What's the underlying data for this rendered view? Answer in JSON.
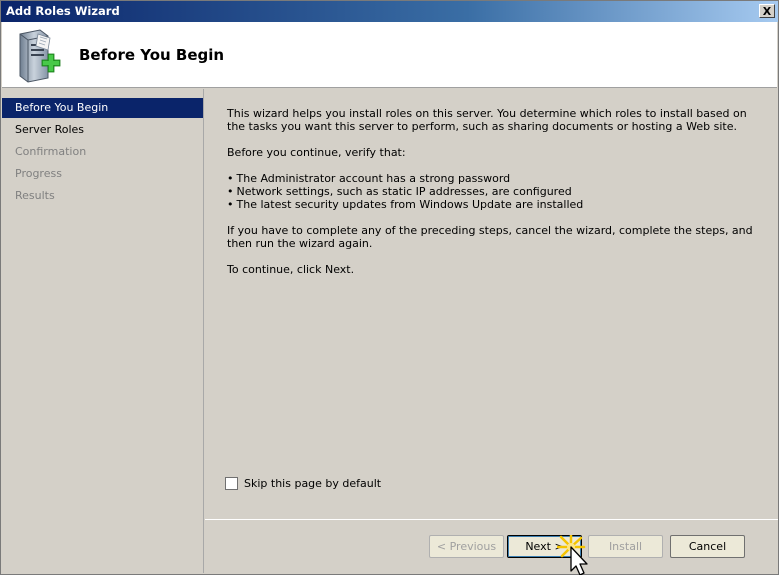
{
  "window": {
    "title": "Add Roles Wizard",
    "close_label": "X"
  },
  "header": {
    "heading": "Before You Begin",
    "icon": "server-add-icon"
  },
  "sidebar": {
    "items": [
      {
        "label": "Before You Begin",
        "state": "active"
      },
      {
        "label": "Server Roles",
        "state": "enabled"
      },
      {
        "label": "Confirmation",
        "state": "disabled"
      },
      {
        "label": "Progress",
        "state": "disabled"
      },
      {
        "label": "Results",
        "state": "disabled"
      }
    ]
  },
  "content": {
    "intro": "This wizard helps you install roles on this server. You determine which roles to install based on the tasks you want this server to perform, such as sharing documents or hosting a Web site.",
    "verify": "Before you continue, verify that:",
    "bullets": [
      "The Administrator account has a strong password",
      "Network settings, such as static IP addresses, are configured",
      "The latest security updates from Windows Update are installed"
    ],
    "cancel_note": "If you have to complete any of the preceding steps, cancel the wizard, complete the steps, and then run the wizard again.",
    "continue_note": "To continue, click Next."
  },
  "skip": {
    "label": "Skip this page by default",
    "checked": false
  },
  "buttons": {
    "previous": "< Previous",
    "next": "Next >",
    "install": "Install",
    "cancel": "Cancel"
  },
  "colors": {
    "accent": "#0a246a",
    "background": "#d4d0c8"
  }
}
